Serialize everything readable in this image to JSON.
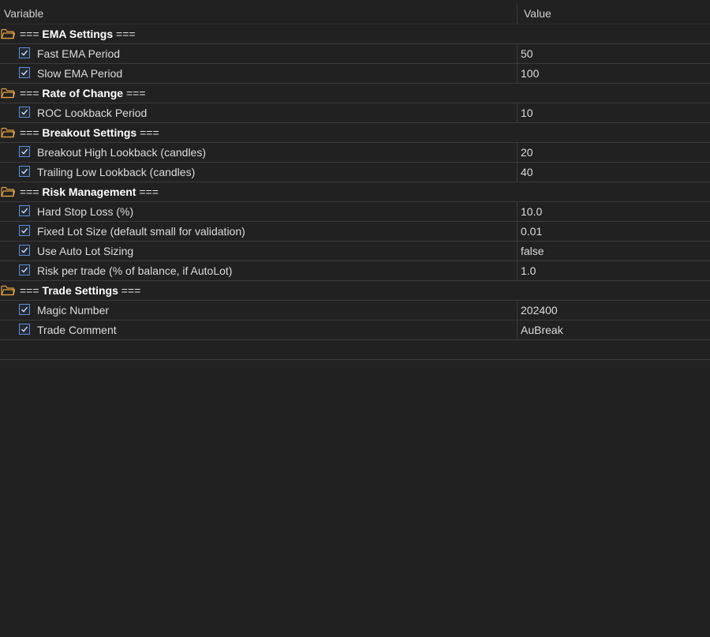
{
  "columns": {
    "variable": "Variable",
    "value": "Value"
  },
  "groups": [
    {
      "label": "EMA Settings",
      "params": [
        {
          "label": "Fast EMA Period",
          "value": "50"
        },
        {
          "label": "Slow EMA Period",
          "value": "100"
        }
      ]
    },
    {
      "label": "Rate of Change",
      "params": [
        {
          "label": "ROC Lookback Period",
          "value": "10"
        }
      ]
    },
    {
      "label": "Breakout Settings",
      "params": [
        {
          "label": "Breakout High Lookback (candles)",
          "value": "20"
        },
        {
          "label": "Trailing Low Lookback (candles)",
          "value": "40"
        }
      ]
    },
    {
      "label": "Risk Management",
      "params": [
        {
          "label": "Hard Stop Loss (%)",
          "value": "10.0"
        },
        {
          "label": "Fixed Lot Size (default small for validation)",
          "value": "0.01"
        },
        {
          "label": "Use Auto Lot Sizing",
          "value": "false"
        },
        {
          "label": "Risk per trade (% of balance, if AutoLot)",
          "value": "1.0"
        }
      ]
    },
    {
      "label": "Trade Settings",
      "params": [
        {
          "label": "Magic Number",
          "value": "202400"
        },
        {
          "label": "Trade Comment",
          "value": "AuBreak"
        }
      ]
    }
  ],
  "group_marker": "===",
  "icons": {
    "group": "folder-icon",
    "param": "checkbox-checked-icon"
  },
  "colors": {
    "background": "#212121",
    "folder": "#e0a040",
    "checkbox": "#5a8fd6"
  }
}
